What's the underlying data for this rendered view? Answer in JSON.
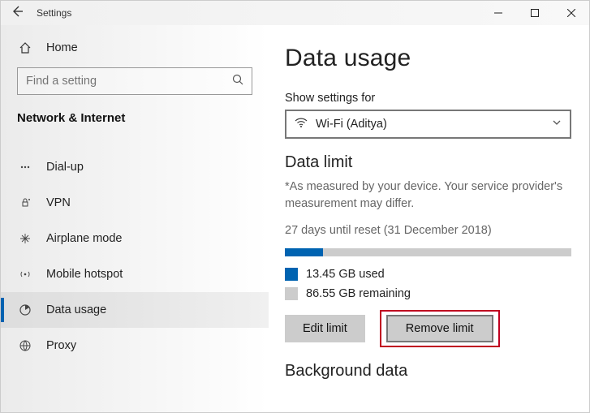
{
  "titlebar": {
    "title": "Settings"
  },
  "sidebar": {
    "home": "Home",
    "search_placeholder": "Find a setting",
    "section": "Network & Internet",
    "items": [
      {
        "label": "Dial-up"
      },
      {
        "label": "VPN"
      },
      {
        "label": "Airplane mode"
      },
      {
        "label": "Mobile hotspot"
      },
      {
        "label": "Data usage"
      },
      {
        "label": "Proxy"
      }
    ]
  },
  "main": {
    "heading": "Data usage",
    "show_for_label": "Show settings for",
    "selected_network": "Wi-Fi (Aditya)",
    "datalimit_heading": "Data limit",
    "disclaimer": "*As measured by your device. Your service provider's measurement may differ.",
    "reset_text": "27 days until reset (31 December 2018)",
    "progress_percent": 13.45,
    "used_text": "13.45 GB used",
    "remaining_text": "86.55 GB remaining",
    "edit_label": "Edit limit",
    "remove_label": "Remove limit",
    "background_heading": "Background data"
  }
}
